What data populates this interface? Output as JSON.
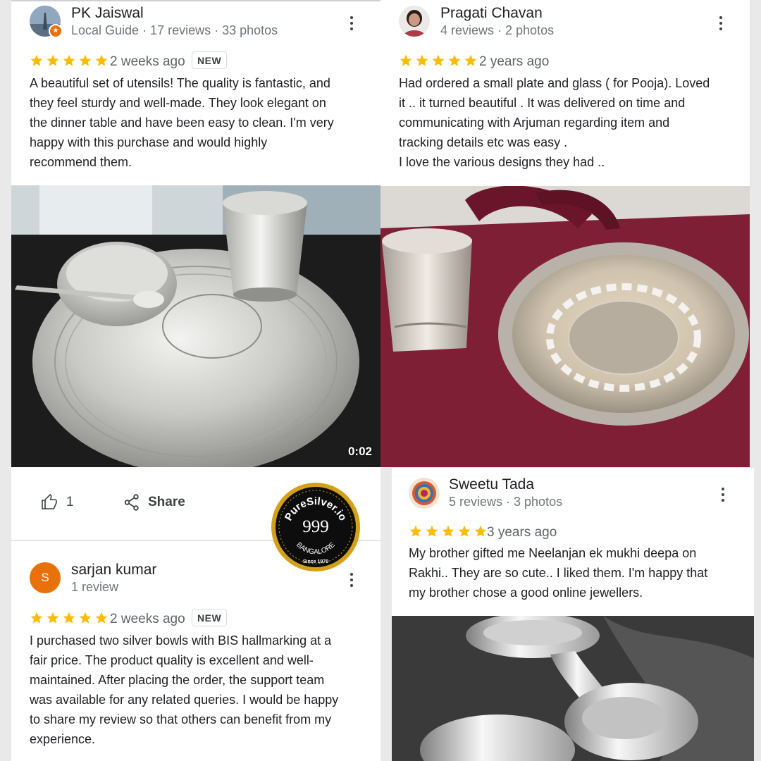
{
  "reviews": [
    {
      "name": "PK Jaiswal",
      "meta": "Local Guide · 17 reviews · 33 photos",
      "rating": 5,
      "time": "2 weeks ago",
      "badge": "NEW",
      "text": "A beautiful set of utensils! The quality is fantastic, and\nthey feel sturdy and well-made. They look elegant on\nthe dinner table and have been easy to clean. I'm very\nhappy with this purchase and would highly\nrecommend them.",
      "media": {
        "kind": "video",
        "duration": "0:02",
        "subject": "silver thali plate with bowl, spoon and glass"
      },
      "likes": "1",
      "share_label": "Share"
    },
    {
      "name": "Pragati Chavan",
      "meta": "4 reviews · 2 photos",
      "rating": 5,
      "time": "2 years ago",
      "text": "Had ordered a small plate and glass ( for Pooja). Loved\nit .. it turned beautiful . It was delivered on time and\ncommunicating with Arjuman regarding item and\ntracking details etc was easy .\nI love the various designs they had ..",
      "media": {
        "kind": "photo",
        "subject": "engraved silver glass and plate on maroon bag"
      }
    },
    {
      "name": "Sweetu Tada",
      "meta": "5 reviews · 3 photos",
      "rating": 5,
      "time": "3 years ago",
      "text": "My brother gifted me Neelanjan ek mukhi deepa on\nRakhi.. They are so cute.. I liked them. I'm happy that\nmy brother chose a good online jewellers.",
      "media": {
        "kind": "photo",
        "subject": "silver deepa lamps"
      }
    },
    {
      "name": "sarjan kumar",
      "avatar_letter": "S",
      "meta": "1 review",
      "rating": 5,
      "time": "2 weeks ago",
      "badge": "NEW",
      "text": "I purchased two silver bowls with BIS hallmarking at a\nfair price. The product quality is excellent and well-\nmaintained. After placing the order, the support team\nwas available for any related queries. I would be happy\nto share my review so that others can benefit from my\nexperience."
    }
  ],
  "seal": {
    "brand": "PureSilver.io",
    "purity": "999",
    "city": "BANGALORE",
    "since": "Since 1970"
  },
  "colors": {
    "star": "#fbbc04",
    "avatar_orange": "#e8710a",
    "seal_gold": "#d4a017",
    "seal_black": "#0d0d0d"
  },
  "icons": [
    "kebab-menu-icon",
    "star-icon",
    "thumbs-up-icon",
    "share-icon",
    "local-guide-badge-icon"
  ]
}
